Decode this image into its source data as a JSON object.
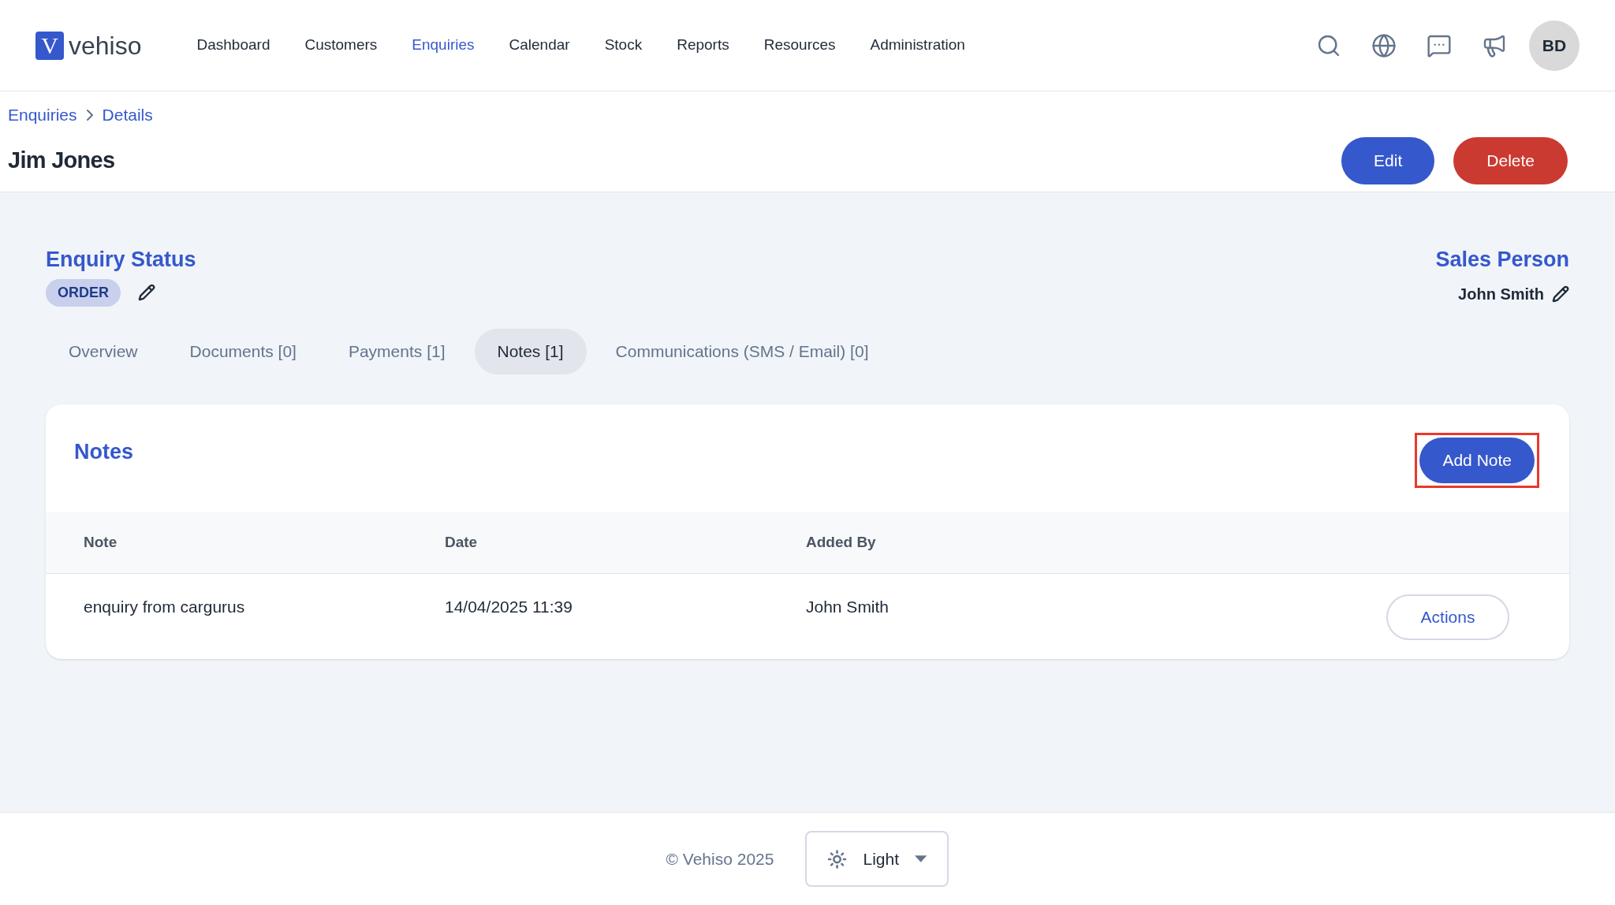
{
  "logo": {
    "mark": "V",
    "name": "vehiso"
  },
  "nav": [
    {
      "label": "Dashboard",
      "selected": false
    },
    {
      "label": "Customers",
      "selected": false
    },
    {
      "label": "Enquiries",
      "selected": true
    },
    {
      "label": "Calendar",
      "selected": false
    },
    {
      "label": "Stock",
      "selected": false
    },
    {
      "label": "Reports",
      "selected": false
    },
    {
      "label": "Resources",
      "selected": false
    },
    {
      "label": "Administration",
      "selected": false
    }
  ],
  "avatar": "BD",
  "breadcrumb": [
    "Enquiries",
    "Details"
  ],
  "title": "Jim Jones",
  "actions": [
    {
      "label": "Edit",
      "kind": "primary"
    },
    {
      "label": "Delete",
      "kind": "danger"
    }
  ],
  "enquiry_status": {
    "heading": "Enquiry Status",
    "badge": "ORDER"
  },
  "sales_person": {
    "heading": "Sales Person",
    "name": "John Smith"
  },
  "tabs": [
    {
      "label": "Overview",
      "selected": false
    },
    {
      "label": "Documents [0]",
      "selected": false
    },
    {
      "label": "Payments [1]",
      "selected": false
    },
    {
      "label": "Notes [1]",
      "selected": true
    },
    {
      "label": "Communications (SMS / Email) [0]",
      "selected": false
    }
  ],
  "notes": {
    "title": "Notes",
    "add_button": "Add Note",
    "highlighted": true,
    "columns": [
      "Note",
      "Date",
      "Added By"
    ],
    "rows": [
      {
        "note": "enquiry from cargurus",
        "date": "14/04/2025 11:39",
        "added_by": "John Smith",
        "action": "Actions"
      }
    ]
  },
  "footer": {
    "copyright": "© Vehiso 2025",
    "theme": "Light"
  }
}
